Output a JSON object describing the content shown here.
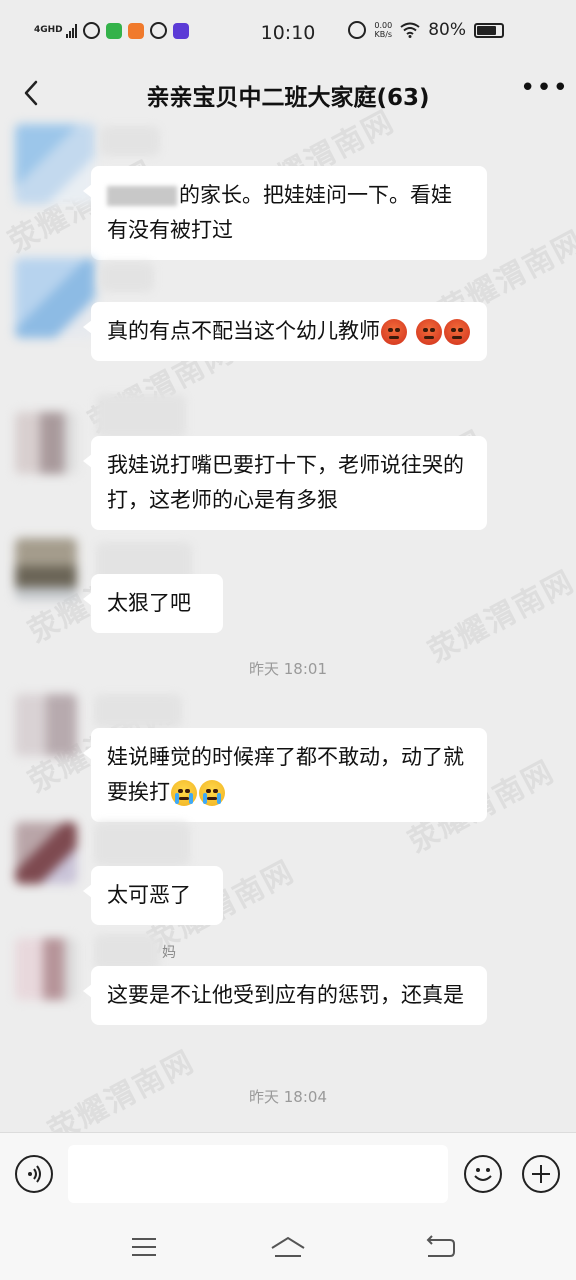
{
  "status_bar": {
    "network": "4GHD",
    "time": "10:10",
    "speed_value": "0.00",
    "speed_unit": "KB/s",
    "battery": "80%",
    "battery_level": 0.8
  },
  "header": {
    "title": "亲亲宝贝中二班大家庭(63)"
  },
  "messages": [
    {
      "text": "的家长。把娃娃问一下。看娃有没有被打过",
      "redacted_prefix": true
    },
    {
      "text": "真的有点不配当这个幼儿教师",
      "emojis": [
        "angry-face",
        "angry-face",
        "angry-face"
      ]
    },
    {
      "text": "我娃说打嘴巴要打十下，老师说往哭的打，这老师的心是有多狠"
    },
    {
      "text": "太狠了吧"
    },
    {
      "text": "娃说睡觉的时候痒了都不敢动，动了就要挨打",
      "emojis": [
        "loudly-crying-face",
        "loudly-crying-face"
      ]
    },
    {
      "text": "太可恶了"
    },
    {
      "sender_fragment": "妈",
      "text": "这要是不让他受到应有的惩罚，还真是"
    }
  ],
  "timestamps": [
    "昨天 18:01",
    "昨天 18:04"
  ],
  "watermark_text": "荥耀渭南网",
  "input_bar": {
    "placeholder": ""
  },
  "icons": {
    "back": "back-arrow-icon",
    "more": "more-dots-icon",
    "voice": "voice-icon",
    "emoji": "emoji-icon",
    "add": "add-icon",
    "menu": "menu-icon",
    "home": "home-icon",
    "return": "return-icon"
  }
}
